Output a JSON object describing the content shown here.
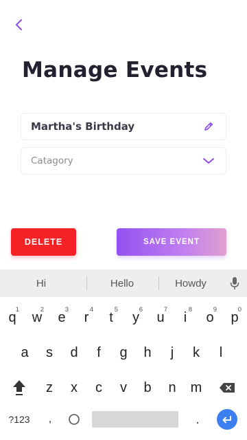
{
  "header": {
    "title": "Manage Events",
    "back_icon": "chevron-left-icon"
  },
  "form": {
    "event_name": "Martha's Birthday",
    "category_placeholder": "Catagory",
    "edit_icon": "pencil-icon",
    "dropdown_icon": "chevron-down-icon"
  },
  "actions": {
    "delete_label": "DELETE",
    "save_label": "SAVE EVENT"
  },
  "colors": {
    "accent": "#9351f0",
    "delete": "#f52226",
    "enter_key": "#3d7ef0"
  },
  "keyboard": {
    "suggestions": [
      "Hi",
      "Hello",
      "Howdy"
    ],
    "row1": [
      "q",
      "w",
      "e",
      "r",
      "t",
      "y",
      "u",
      "i",
      "o",
      "p"
    ],
    "row1_numbers": [
      "1",
      "2",
      "3",
      "4",
      "5",
      "6",
      "7",
      "8",
      "9",
      "0"
    ],
    "row2": [
      "a",
      "s",
      "d",
      "f",
      "g",
      "h",
      "j",
      "k",
      "l"
    ],
    "row3": [
      "z",
      "x",
      "c",
      "v",
      "b",
      "n",
      "m"
    ],
    "symbols_label": "?123",
    "comma": ",",
    "period": "."
  }
}
